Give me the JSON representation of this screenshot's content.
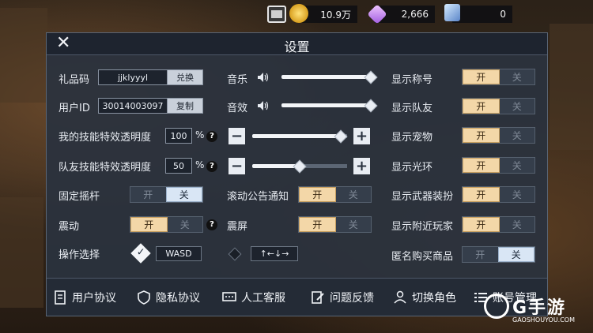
{
  "topbar": {
    "gold": "10.9万",
    "diamond": "2,666",
    "card": "0"
  },
  "dialog": {
    "title": "设置"
  },
  "left": {
    "gift_code_label": "礼品码",
    "gift_code_value": "jjklyyyl",
    "redeem_button": "兑换",
    "user_id_label": "用户ID",
    "user_id_value": "30014003097",
    "copy_button": "复制",
    "my_skill_label": "我的技能特效透明度",
    "my_skill_value": "100",
    "team_skill_label": "队友技能特效透明度",
    "team_skill_value": "50",
    "percent": "%",
    "joystick_label": "固定摇杆",
    "vibration_label": "震动",
    "control_label": "操作选择",
    "control_opt1": "WASD",
    "control_opt2": "↑←↓→"
  },
  "middle": {
    "music_label": "音乐",
    "sfx_label": "音效",
    "scroll_notice_label": "滚动公告通知",
    "screen_shake_label": "震屏",
    "my_skill_slider": 0.93,
    "team_skill_slider": 0.5
  },
  "right": {
    "title_label": "显示称号",
    "team_label": "显示队友",
    "pet_label": "显示宠物",
    "halo_label": "显示光环",
    "weapon_label": "显示武器装扮",
    "nearby_label": "显示附近玩家",
    "anon_label": "匿名购买商品"
  },
  "toggle": {
    "on": "开",
    "off": "关"
  },
  "help": "?",
  "footer": {
    "agreement": "用户协议",
    "privacy": "隐私协议",
    "service": "人工客服",
    "feedback": "问题反馈",
    "switch_role": "切换角色",
    "account": "账号管理"
  },
  "watermark": {
    "name": "G手游",
    "url": "GAOSHOUYOU.COM"
  },
  "colors": {
    "toggle_on": "#f3d7a8",
    "toggle_off_selected": "#d9e6f5",
    "panel": "#2a323e"
  }
}
